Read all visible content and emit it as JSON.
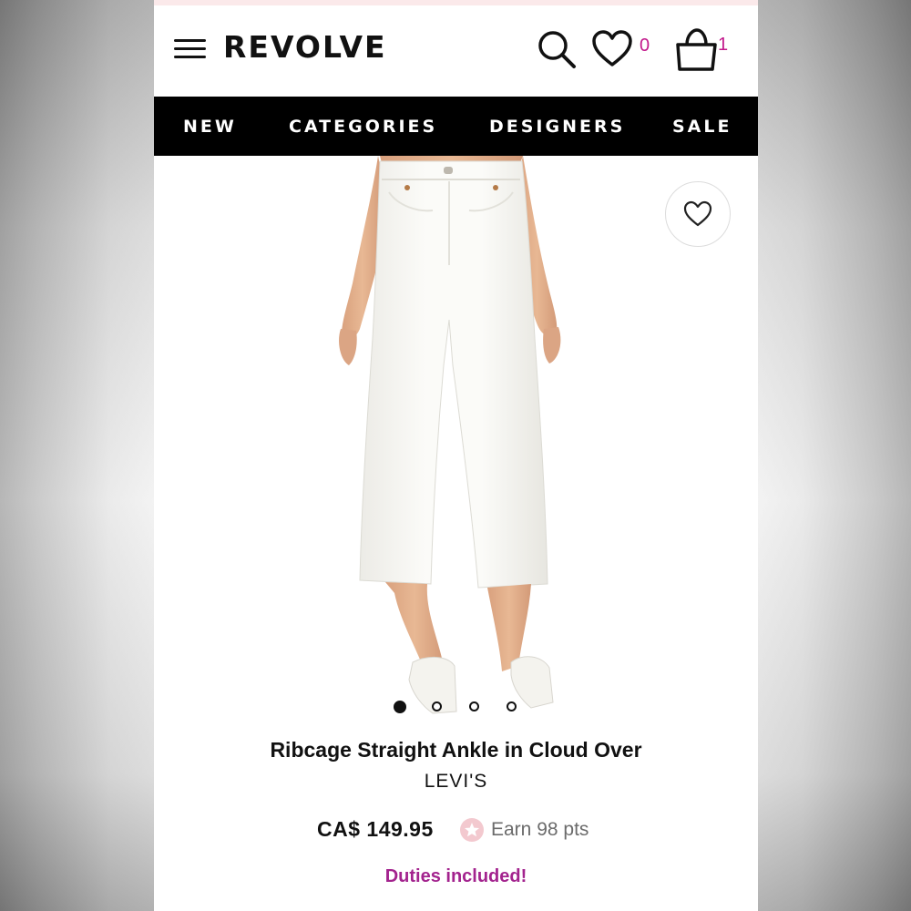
{
  "header": {
    "logo": "REVOLVE",
    "wishlist_count": "0",
    "bag_count": "1"
  },
  "nav": {
    "items": [
      "NEW",
      "CATEGORIES",
      "DESIGNERS",
      "SALE"
    ]
  },
  "gallery": {
    "image_alt": "model wearing white cropped straight jeans with white mule sandals",
    "current_image": 1,
    "image_count": 4
  },
  "product": {
    "title": "Ribcage Straight Ankle in Cloud Over",
    "brand": "LEVI'S",
    "price": "CA$ 149.95",
    "points": "Earn 98 pts",
    "duties_note": "Duties included!"
  },
  "colors": {
    "accent": "#c2188b",
    "duties": "#a3238e",
    "nav_bg": "#000000",
    "points_star": "#f3c9cf"
  },
  "icons": [
    "menu-icon",
    "search-icon",
    "heart-icon",
    "bag-icon",
    "heart-outline-icon",
    "star-icon"
  ]
}
